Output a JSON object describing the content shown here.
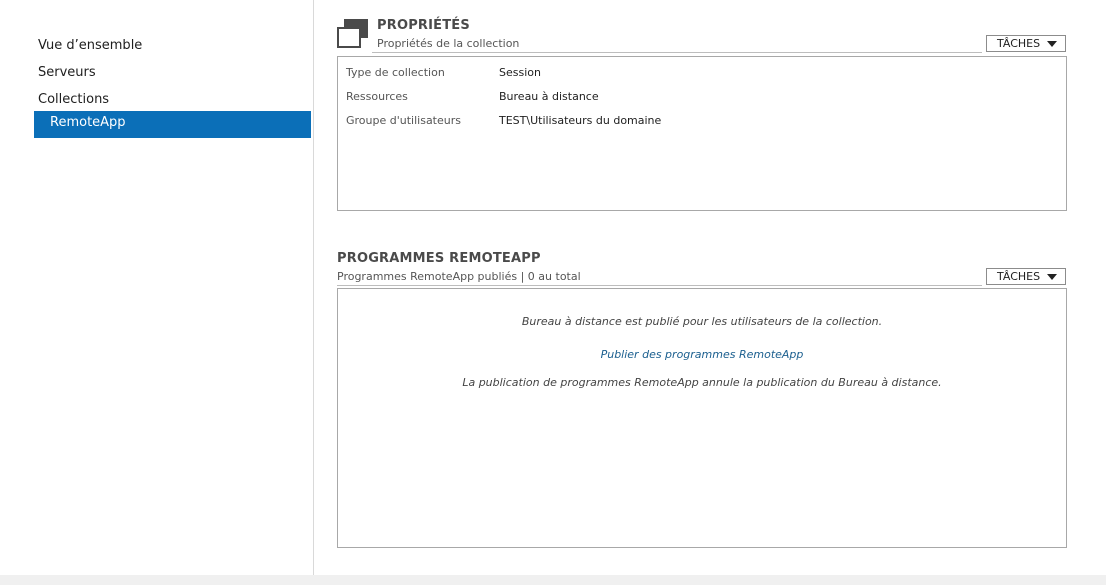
{
  "sidebar": {
    "items": [
      {
        "label": "Vue d’ensemble"
      },
      {
        "label": "Serveurs"
      },
      {
        "label": "Collections"
      },
      {
        "label": "RemoteApp"
      }
    ]
  },
  "properties": {
    "title": "PROPRIÉTÉS",
    "subtitle": "Propriétés de la collection",
    "tasks_label": "TÂCHES",
    "rows": [
      {
        "key": "Type de collection",
        "value": "Session"
      },
      {
        "key": "Ressources",
        "value": "Bureau à distance"
      },
      {
        "key": "Groupe d'utilisateurs",
        "value": "TEST\\Utilisateurs du domaine"
      }
    ]
  },
  "remoteapp": {
    "title": "PROGRAMMES REMOTEAPP",
    "subtitle": "Programmes RemoteApp publiés | 0 au total",
    "tasks_label": "TÂCHES",
    "message1": "Bureau à distance est publié pour les utilisateurs de la collection.",
    "link": "Publier des programmes RemoteApp",
    "message2": "La publication de programmes RemoteApp annule la publication du Bureau à distance."
  },
  "colors": {
    "selected_bg": "#0b6fb8",
    "link": "#1b5f8f"
  }
}
